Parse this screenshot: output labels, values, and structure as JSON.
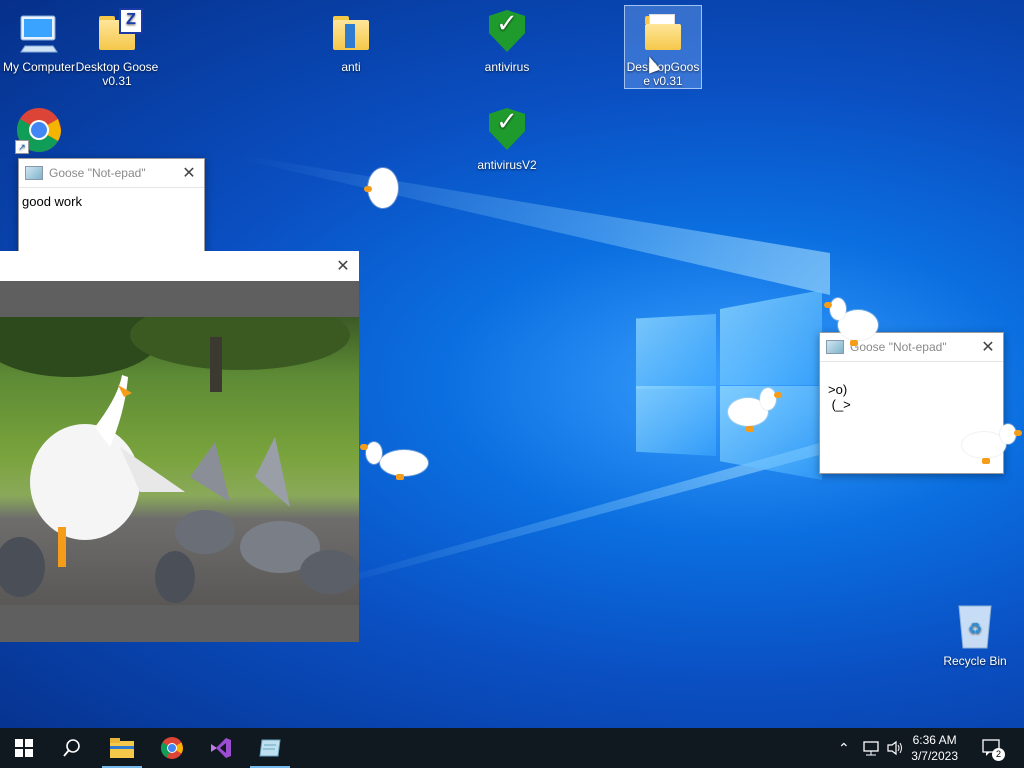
{
  "desktop_icons": {
    "my_computer": "My Computer",
    "desktop_goose": "Desktop Goose v0.31",
    "anti": "anti",
    "antivirus": "antivirus",
    "antivirus_v2": "antivirusV2",
    "desktopgoose_folder": "DesktopGoose v0.31",
    "recycle_bin": "Recycle Bin"
  },
  "notepad_left": {
    "title": "Goose \"Not-epad\"",
    "text": "good work"
  },
  "notepad_right": {
    "title": "Goose \"Not-epad\"",
    "text": ">o)\n (_>"
  },
  "taskbar": {
    "time": "6:36 AM",
    "date": "3/7/2023",
    "notification_count": "2",
    "apps": [
      "start",
      "search",
      "file-explorer",
      "chrome",
      "visual-studio",
      "goose-notepad"
    ]
  },
  "colors": {
    "goose_beak": "#f59d1a",
    "shield_green": "#1f9a2c",
    "taskbar_bg": "#101820"
  }
}
